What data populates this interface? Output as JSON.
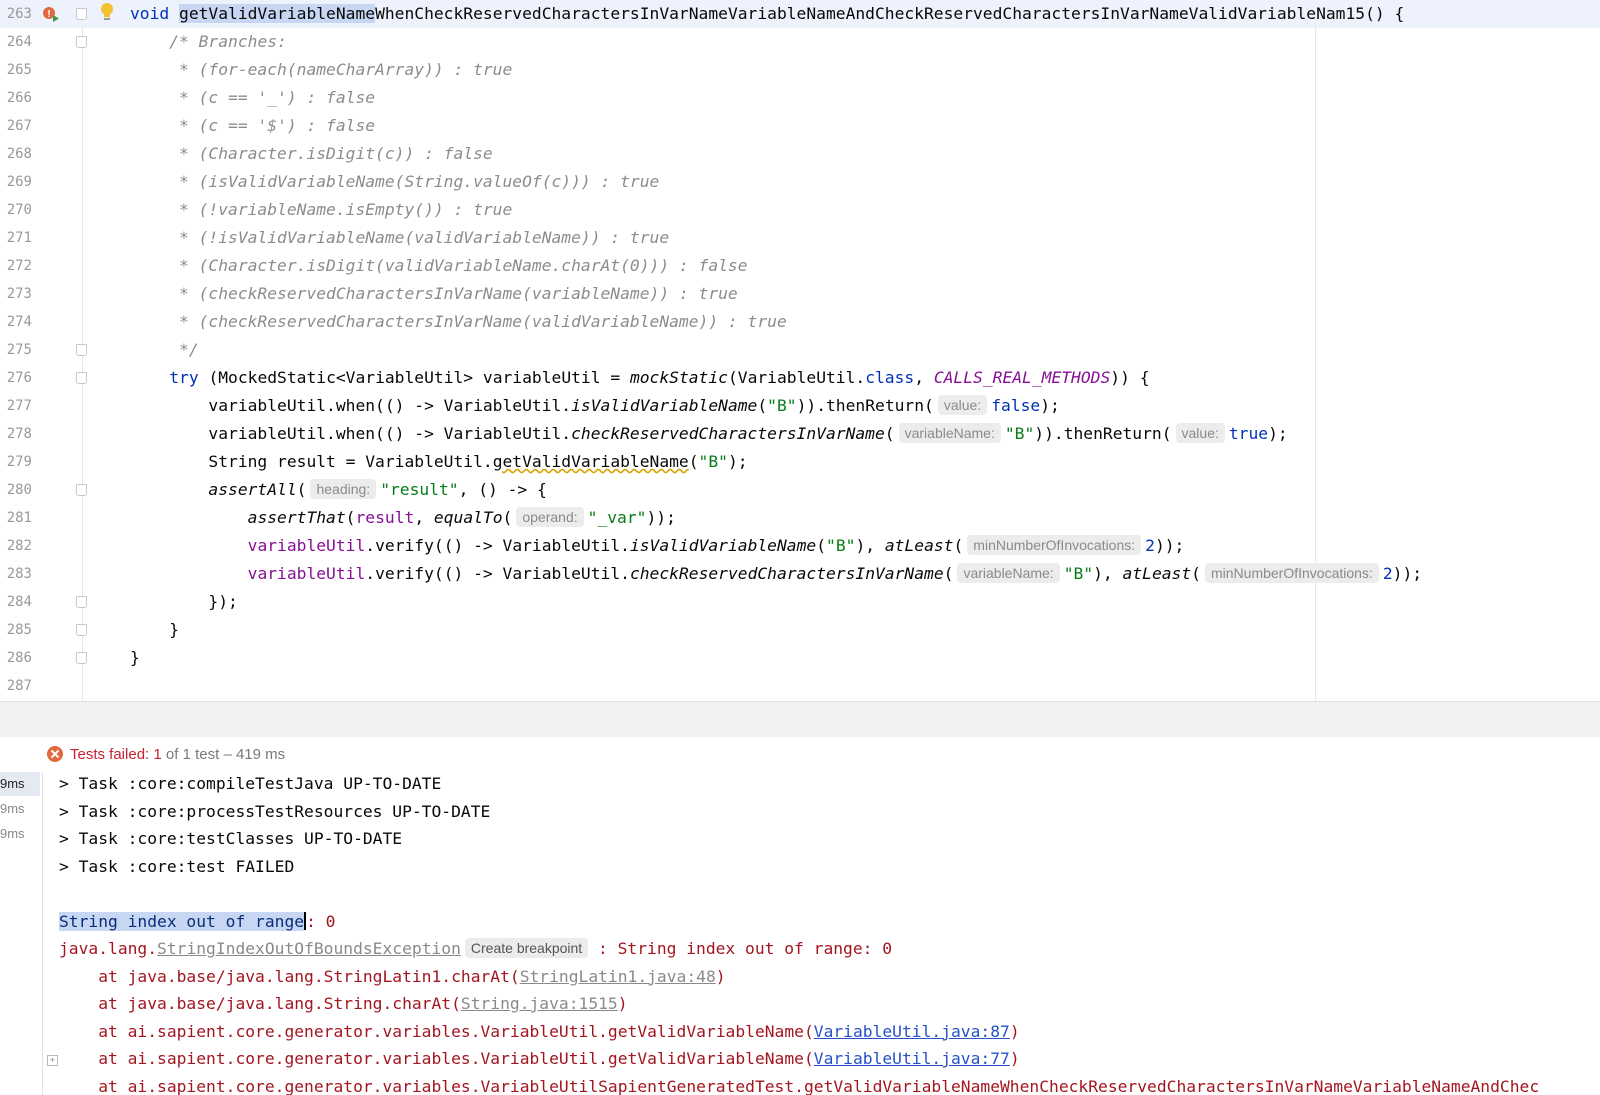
{
  "editor": {
    "lines": [
      {
        "n": "263",
        "parts": [
          [
            "kw",
            "void "
          ],
          [
            "sel",
            "getValidVariableName"
          ],
          [
            "",
            "WhenCheckReservedCharactersInVarNameVariableNameAndCheckReservedCharactersInVarNameValidVariableNam15() {"
          ]
        ]
      },
      {
        "n": "264",
        "parts": [
          [
            "",
            "    "
          ],
          [
            "cm",
            "/* Branches:"
          ]
        ]
      },
      {
        "n": "265",
        "parts": [
          [
            "",
            "     "
          ],
          [
            "cm",
            "* (for-each(nameCharArray)) : true"
          ]
        ]
      },
      {
        "n": "266",
        "parts": [
          [
            "",
            "     "
          ],
          [
            "cm",
            "* (c == '_') : false"
          ]
        ]
      },
      {
        "n": "267",
        "parts": [
          [
            "",
            "     "
          ],
          [
            "cm",
            "* (c == '$') : false"
          ]
        ]
      },
      {
        "n": "268",
        "parts": [
          [
            "",
            "     "
          ],
          [
            "cm",
            "* (Character.isDigit(c)) : false"
          ]
        ]
      },
      {
        "n": "269",
        "parts": [
          [
            "",
            "     "
          ],
          [
            "cm",
            "* (isValidVariableName(String.valueOf(c))) : true"
          ]
        ]
      },
      {
        "n": "270",
        "parts": [
          [
            "",
            "     "
          ],
          [
            "cm",
            "* (!variableName.isEmpty()) : true"
          ]
        ]
      },
      {
        "n": "271",
        "parts": [
          [
            "",
            "     "
          ],
          [
            "cm",
            "* (!isValidVariableName(validVariableName)) : true"
          ]
        ]
      },
      {
        "n": "272",
        "parts": [
          [
            "",
            "     "
          ],
          [
            "cm",
            "* (Character.isDigit(validVariableName.charAt(0))) : false"
          ]
        ]
      },
      {
        "n": "273",
        "parts": [
          [
            "",
            "     "
          ],
          [
            "cm",
            "* (checkReservedCharactersInVarName(variableName)) : true"
          ]
        ]
      },
      {
        "n": "274",
        "parts": [
          [
            "",
            "     "
          ],
          [
            "cm",
            "* (checkReservedCharactersInVarName(validVariableName)) : true"
          ]
        ]
      },
      {
        "n": "275",
        "parts": [
          [
            "",
            "     "
          ],
          [
            "cm",
            "*/"
          ]
        ]
      },
      {
        "n": "276",
        "parts": [
          [
            "",
            "    "
          ],
          [
            "kw",
            "try"
          ],
          [
            "",
            " (MockedStatic<VariableUtil> variableUtil = "
          ],
          [
            "it",
            "mockStatic"
          ],
          [
            "",
            "(VariableUtil."
          ],
          [
            "kw",
            "class"
          ],
          [
            "",
            ", "
          ],
          [
            "cst",
            "CALLS_REAL_METHODS"
          ],
          [
            "",
            ")) {"
          ]
        ]
      },
      {
        "n": "277",
        "parts": [
          [
            "",
            "        variableUtil.when(() -> VariableUtil."
          ],
          [
            "it",
            "isValidVariableName"
          ],
          [
            "",
            "("
          ],
          [
            "str",
            "\"B\""
          ],
          [
            "",
            ")).thenReturn("
          ],
          [
            "hint",
            "value:"
          ],
          [
            "kw",
            "false"
          ],
          [
            "",
            ");"
          ]
        ]
      },
      {
        "n": "278",
        "parts": [
          [
            "",
            "        variableUtil.when(() -> VariableUtil."
          ],
          [
            "it",
            "checkReservedCharactersInVarName"
          ],
          [
            "",
            "("
          ],
          [
            "hint",
            "variableName:"
          ],
          [
            "str",
            "\"B\""
          ],
          [
            "",
            ")).thenReturn("
          ],
          [
            "hint",
            "value:"
          ],
          [
            "kw",
            "true"
          ],
          [
            "",
            ");"
          ]
        ]
      },
      {
        "n": "279",
        "parts": [
          [
            "",
            "        String result = VariableUtil."
          ],
          [
            "ul",
            "getValidVariableName"
          ],
          [
            "",
            "("
          ],
          [
            "str",
            "\"B\""
          ],
          [
            "",
            ");"
          ]
        ]
      },
      {
        "n": "280",
        "parts": [
          [
            "",
            "        "
          ],
          [
            "it",
            "assertAll"
          ],
          [
            "",
            "("
          ],
          [
            "hint",
            "heading:"
          ],
          [
            "str",
            "\"result\""
          ],
          [
            "",
            ", () -> {"
          ]
        ]
      },
      {
        "n": "281",
        "parts": [
          [
            "",
            "            "
          ],
          [
            "it",
            "assertThat"
          ],
          [
            "",
            "("
          ],
          [
            "fld",
            "result"
          ],
          [
            "",
            ", "
          ],
          [
            "it",
            "equalTo"
          ],
          [
            "",
            "("
          ],
          [
            "hint",
            "operand:"
          ],
          [
            "str",
            "\"_var\""
          ],
          [
            "",
            "));"
          ]
        ]
      },
      {
        "n": "282",
        "parts": [
          [
            "",
            "            "
          ],
          [
            "fld",
            "variableUtil"
          ],
          [
            "",
            ".verify(() -> VariableUtil."
          ],
          [
            "it",
            "isValidVariableName"
          ],
          [
            "",
            "("
          ],
          [
            "str",
            "\"B\""
          ],
          [
            "",
            "), "
          ],
          [
            "it",
            "atLeast"
          ],
          [
            "",
            "("
          ],
          [
            "hint",
            "minNumberOfInvocations:"
          ],
          [
            "kw",
            "2"
          ],
          [
            "",
            "));"
          ]
        ]
      },
      {
        "n": "283",
        "parts": [
          [
            "",
            "            "
          ],
          [
            "fld",
            "variableUtil"
          ],
          [
            "",
            ".verify(() -> VariableUtil."
          ],
          [
            "it",
            "checkReservedCharactersInVarName"
          ],
          [
            "",
            "("
          ],
          [
            "hint",
            "variableName:"
          ],
          [
            "str",
            "\"B\""
          ],
          [
            "",
            "), "
          ],
          [
            "it",
            "atLeast"
          ],
          [
            "",
            "("
          ],
          [
            "hint",
            "minNumberOfInvocations:"
          ],
          [
            "kw",
            "2"
          ],
          [
            "",
            "));"
          ]
        ]
      },
      {
        "n": "284",
        "parts": [
          [
            "",
            "        });"
          ]
        ]
      },
      {
        "n": "285",
        "parts": [
          [
            "",
            "    }"
          ]
        ]
      },
      {
        "n": "286",
        "parts": [
          [
            "",
            "}"
          ]
        ]
      },
      {
        "n": "287",
        "parts": []
      }
    ],
    "fold_lines": [
      "263",
      "264",
      "275",
      "276",
      "280",
      "284",
      "285",
      "286"
    ]
  },
  "run_panel": {
    "status": {
      "label": "Tests failed:",
      "failed": "1",
      "rest": "of 1 test – 419 ms"
    },
    "durations": [
      "9ms",
      "9ms",
      "9ms"
    ],
    "console": [
      {
        "parts": [
          [
            "",
            "> Task :core:compileTestJava UP-TO-DATE"
          ]
        ]
      },
      {
        "parts": [
          [
            "",
            "> Task :core:processTestResources UP-TO-DATE"
          ]
        ]
      },
      {
        "parts": [
          [
            "",
            "> Task :core:testClasses UP-TO-DATE"
          ]
        ]
      },
      {
        "parts": [
          [
            "",
            "> Task :core:test FAILED"
          ]
        ]
      },
      {
        "parts": []
      },
      {
        "parts": [
          [
            "csel",
            "String index out of range"
          ],
          [
            "caret",
            ""
          ],
          [
            "err",
            ": 0"
          ]
        ]
      },
      {
        "parts": [
          [
            "err",
            "java.lang."
          ],
          [
            "glink",
            "StringIndexOutOfBoundsException"
          ],
          [
            "bp",
            "Create breakpoint"
          ],
          [
            "err",
            " : String index out of range: 0"
          ]
        ]
      },
      {
        "parts": [
          [
            "err",
            "    at java.base/java.lang.StringLatin1.charAt("
          ],
          [
            "glink",
            "StringLatin1.java:48"
          ],
          [
            "err",
            ")"
          ]
        ]
      },
      {
        "parts": [
          [
            "err",
            "    at java.base/java.lang.String.charAt("
          ],
          [
            "glink",
            "String.java:1515"
          ],
          [
            "err",
            ")"
          ]
        ]
      },
      {
        "parts": [
          [
            "err",
            "    at ai.sapient.core.generator.variables.VariableUtil.getValidVariableName("
          ],
          [
            "link",
            "VariableUtil.java:87"
          ],
          [
            "err",
            ")"
          ]
        ]
      },
      {
        "parts": [
          [
            "err",
            "    at ai.sapient.core.generator.variables.VariableUtil.getValidVariableName("
          ],
          [
            "link",
            "VariableUtil.java:77"
          ],
          [
            "err",
            ")"
          ]
        ]
      },
      {
        "parts": [
          [
            "err",
            "    at ai.sapient.core.generator.variables.VariableUtilSapientGeneratedTest.getValidVariableNameWhenCheckReservedCharactersInVarNameVariableNameAndChec"
          ]
        ]
      }
    ]
  },
  "colors": {
    "keyword": "#0033b3",
    "string": "#067d17",
    "comment": "#8c8c8c",
    "error": "#a3151f",
    "fail": "#c7222d"
  }
}
